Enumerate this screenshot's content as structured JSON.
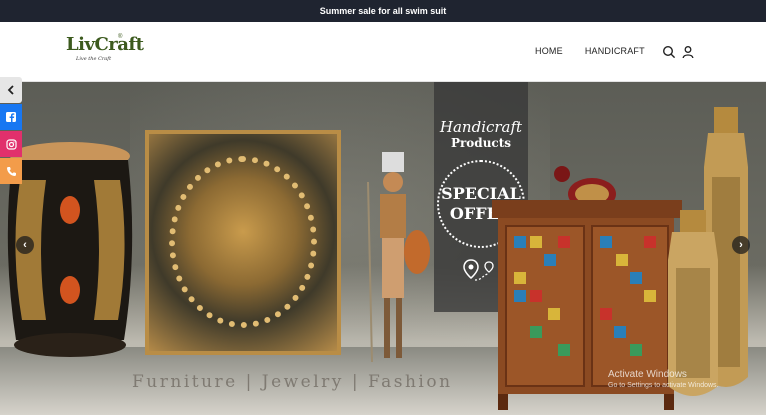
{
  "announcement": {
    "text": "Summer sale for all swim suit"
  },
  "logo": {
    "name": "LivCraft",
    "registered": "®",
    "tagline": "Live the Craft"
  },
  "nav": {
    "items": [
      {
        "label": "HOME"
      },
      {
        "label": "HANDICRAFT"
      }
    ]
  },
  "icons": {
    "search": "search-icon",
    "user": "user-icon",
    "prev": "chevron-left-icon",
    "next": "chevron-right-icon",
    "toggle": "chevron-left-icon"
  },
  "hero": {
    "promo_script": "Handicraft",
    "promo_title": "Products",
    "offer_line1": "SPECIAL",
    "offer_line2": "OFFER",
    "tagline": "Furniture | Jewelry | Fashion"
  },
  "social": {
    "colors": {
      "facebook": "#1877f2",
      "instagram": "#e1306c",
      "phone": "#f39c4a",
      "toggle": "#e6e6e6"
    }
  },
  "watermark": {
    "title": "Activate Windows",
    "subtitle": "Go to Settings to activate Windows."
  },
  "colors": {
    "topbar": "#1f2430",
    "brand": "#3c5a1e"
  }
}
